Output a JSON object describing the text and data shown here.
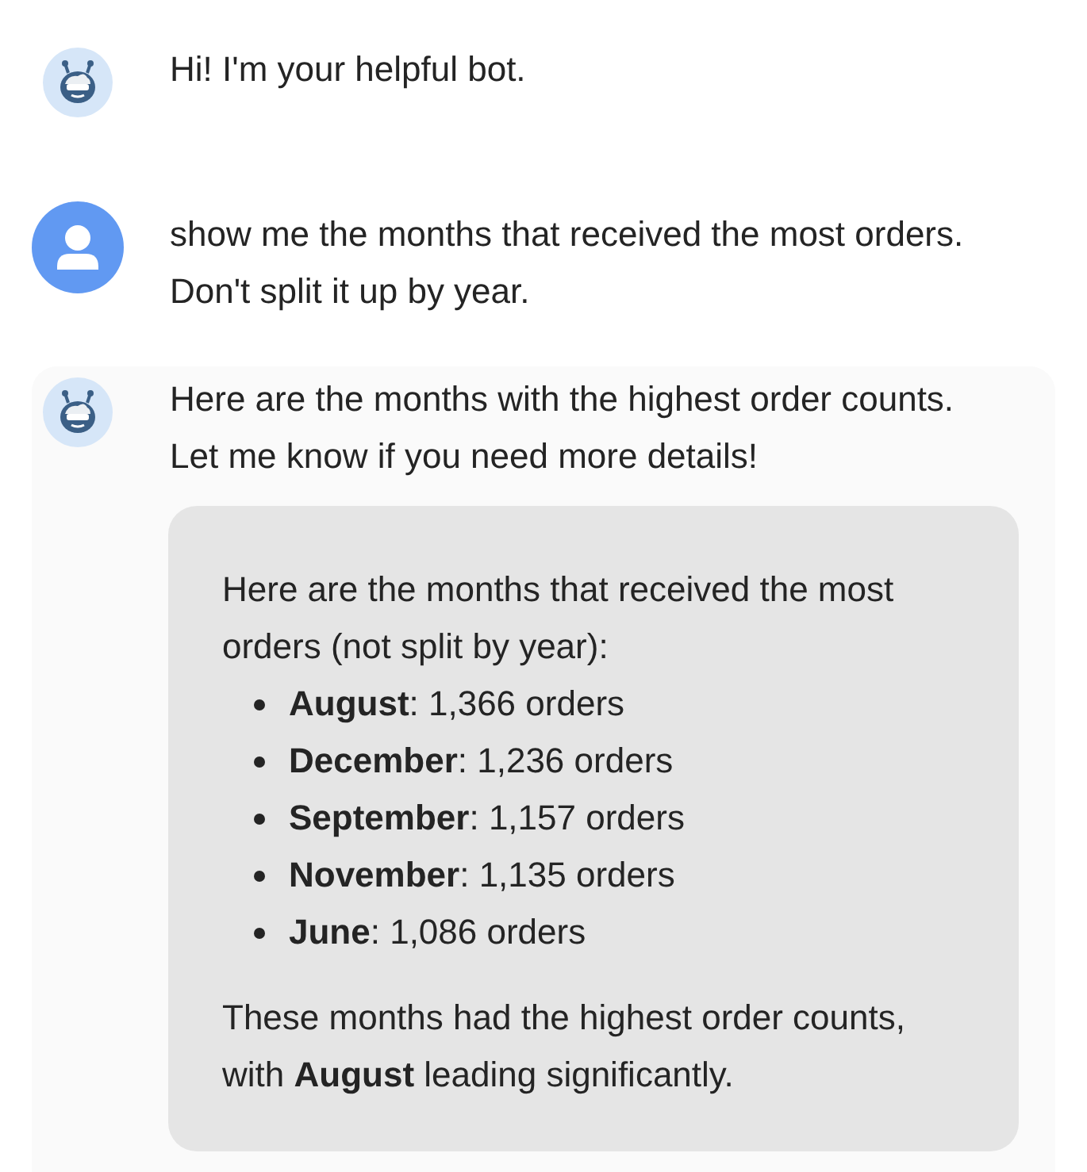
{
  "messages": [
    {
      "kind": "bot",
      "lines": [
        "Hi! I'm your helpful bot."
      ]
    },
    {
      "kind": "user",
      "lines": [
        "show me the months that received the most orders.",
        "Don't split it up by year."
      ]
    },
    {
      "kind": "bot",
      "lines": [
        "Here are the months with the highest order counts.",
        "Let me know if you need more details!"
      ],
      "card": {
        "intro": "Here are the months that received the most orders (not split by year):",
        "items": [
          "**August**: 1,366 orders",
          "**December**: 1,236 orders",
          "**September**: 1,157 orders",
          "**November**: 1,135 orders",
          "**June**: 1,086 orders"
        ],
        "outro": "These months had the highest order counts, with **August** leading significantly."
      }
    }
  ]
}
